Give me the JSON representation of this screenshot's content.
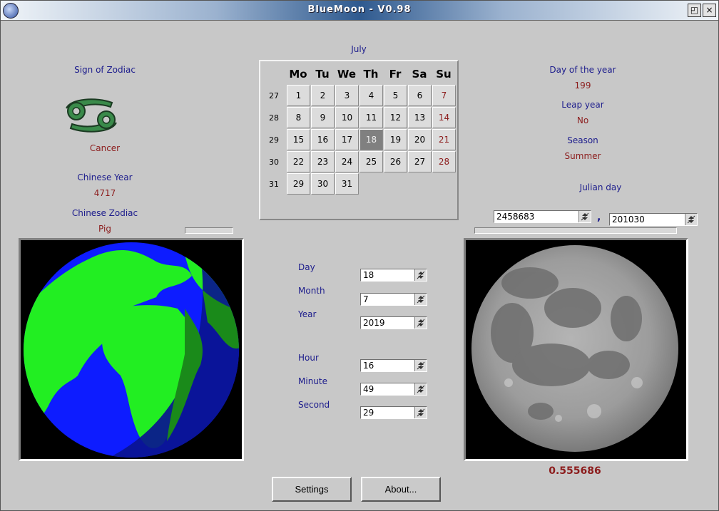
{
  "window": {
    "title": "BlueMoon - V0.98",
    "maximize_glyph": "◰",
    "close_glyph": "×"
  },
  "zodiac": {
    "label": "Sign of Zodiac",
    "sign": "Cancer",
    "icon": "cancer-sign-icon",
    "icon_color": "#3a8a4a"
  },
  "chinese_year": {
    "label": "Chinese Year",
    "value": "4717"
  },
  "chinese_zodiac": {
    "label": "Chinese Zodiac",
    "value": "Pig"
  },
  "calendar": {
    "month": "July",
    "day_headers": [
      "Mo",
      "Tu",
      "We",
      "Th",
      "Fr",
      "Sa",
      "Su"
    ],
    "weeks": [
      {
        "week": "27",
        "days": [
          "1",
          "2",
          "3",
          "4",
          "5",
          "6",
          "7"
        ]
      },
      {
        "week": "28",
        "days": [
          "8",
          "9",
          "10",
          "11",
          "12",
          "13",
          "14"
        ]
      },
      {
        "week": "29",
        "days": [
          "15",
          "16",
          "17",
          "18",
          "19",
          "20",
          "21"
        ]
      },
      {
        "week": "30",
        "days": [
          "22",
          "23",
          "24",
          "25",
          "26",
          "27",
          "28"
        ]
      },
      {
        "week": "31",
        "days": [
          "29",
          "30",
          "31"
        ]
      }
    ],
    "selected_day": "18"
  },
  "day_of_year": {
    "label": "Day of the year",
    "value": "199"
  },
  "leap_year": {
    "label": "Leap year",
    "value": "No"
  },
  "season": {
    "label": "Season",
    "value": "Summer"
  },
  "julian": {
    "label": "Julian day",
    "value": "2458683",
    "separator": ",",
    "fraction": "201030"
  },
  "datetime": {
    "day": {
      "label": "Day",
      "value": "18"
    },
    "month": {
      "label": "Month",
      "value": "7"
    },
    "year": {
      "label": "Year",
      "value": "2019"
    },
    "hour": {
      "label": "Hour",
      "value": "16"
    },
    "minute": {
      "label": "Minute",
      "value": "49"
    },
    "second": {
      "label": "Second",
      "value": "29"
    }
  },
  "earth_view": {
    "icon": "earth-globe-icon",
    "ocean_color": "#0d1cff",
    "land_color": "#22ee22",
    "night_ocean": "#0a1490",
    "night_land": "#1a8a1a"
  },
  "moon_view": {
    "icon": "moon-phase-icon"
  },
  "moon_phase": "0.555686",
  "buttons": {
    "settings": "Settings",
    "about": "About..."
  }
}
